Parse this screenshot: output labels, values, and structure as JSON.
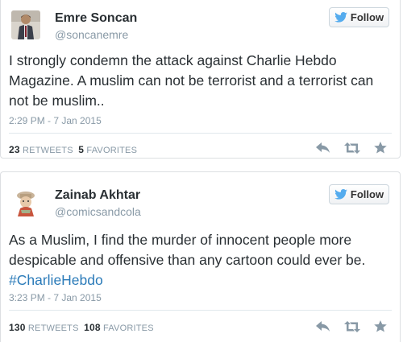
{
  "tweets": [
    {
      "name": "Emre Soncan",
      "handle": "@soncanemre",
      "follow_label": "Follow",
      "text": "I strongly condemn the attack against Charlie Hebdo Magazine. A muslim can not be terrorist and a terrorist can not be muslim..",
      "timestamp": "2:29 PM - 7 Jan 2015",
      "retweets_count": "23",
      "retweets_label": "RETWEETS",
      "favorites_count": "5",
      "favorites_label": "FAVORITES"
    },
    {
      "name": "Zainab Akhtar",
      "handle": "@comicsandcola",
      "follow_label": "Follow",
      "text_before": "As a Muslim, I find the murder of innocent people more despicable and offensive than any cartoon could ever be. ",
      "hashtag": "#CharlieHebdo",
      "timestamp": "3:23 PM - 7 Jan 2015",
      "retweets_count": "130",
      "retweets_label": "RETWEETS",
      "favorites_count": "108",
      "favorites_label": "FAVORITES"
    }
  ],
  "icons": {
    "follow": "bird-icon",
    "reply": "reply-icon",
    "retweet": "retweet-icon",
    "favorite": "star-icon"
  },
  "colors": {
    "link": "#2b7bb9",
    "bird": "#55acee",
    "muted": "#8899a6"
  }
}
